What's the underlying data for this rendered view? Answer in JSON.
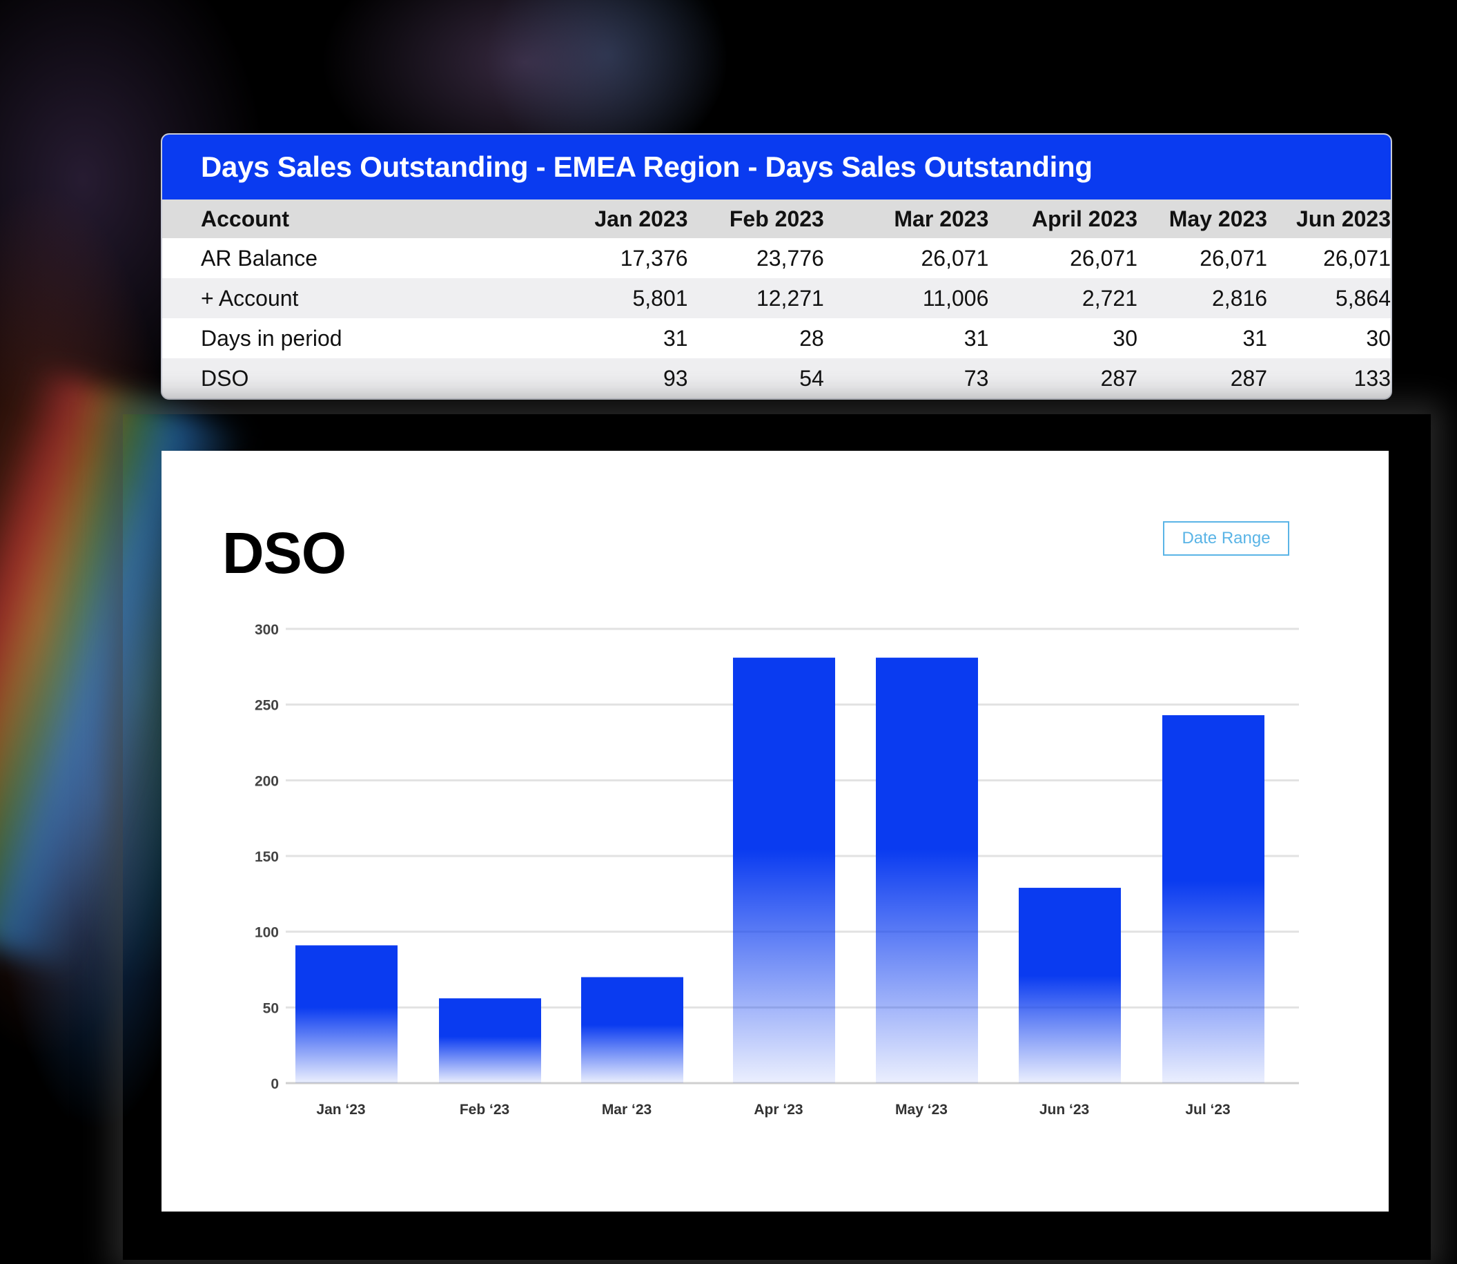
{
  "table": {
    "title": "Days Sales Outstanding - EMEA Region - Days Sales Outstanding",
    "columns": [
      "Account",
      "Jan 2023",
      "Feb 2023",
      "Mar 2023",
      "April 2023",
      "May 2023",
      "Jun 2023"
    ],
    "rows": [
      {
        "label": "AR Balance",
        "values": [
          "17,376",
          "23,776",
          "26,071",
          "26,071",
          "26,071",
          "26,071"
        ]
      },
      {
        "label": "+ Account",
        "values": [
          "5,801",
          "12,271",
          "11,006",
          "2,721",
          "2,816",
          "5,864"
        ]
      },
      {
        "label": "Days in period",
        "values": [
          "31",
          "28",
          "31",
          "30",
          "31",
          "30"
        ]
      },
      {
        "label": "DSO",
        "values": [
          "93",
          "54",
          "73",
          "287",
          "287",
          "133"
        ]
      }
    ]
  },
  "chart": {
    "date_range_label": "Date Range"
  },
  "chart_data": {
    "type": "bar",
    "title": "DSO",
    "xlabel": "",
    "ylabel": "",
    "categories": [
      "Jan ‘23",
      "Feb ‘23",
      "Mar ‘23",
      "Apr ‘23",
      "May ‘23",
      "Jun ‘23",
      "Jul ‘23"
    ],
    "values": [
      91,
      56,
      70,
      281,
      281,
      129,
      243
    ],
    "ylim": [
      0,
      300
    ],
    "yticks": [
      0,
      50,
      100,
      150,
      200,
      250,
      300
    ],
    "grid": true,
    "legend": "none",
    "bar_color": "#0a3bf0"
  },
  "colors": {
    "header_blue": "#0a3bf0",
    "button_outline": "#5ab4e6"
  }
}
